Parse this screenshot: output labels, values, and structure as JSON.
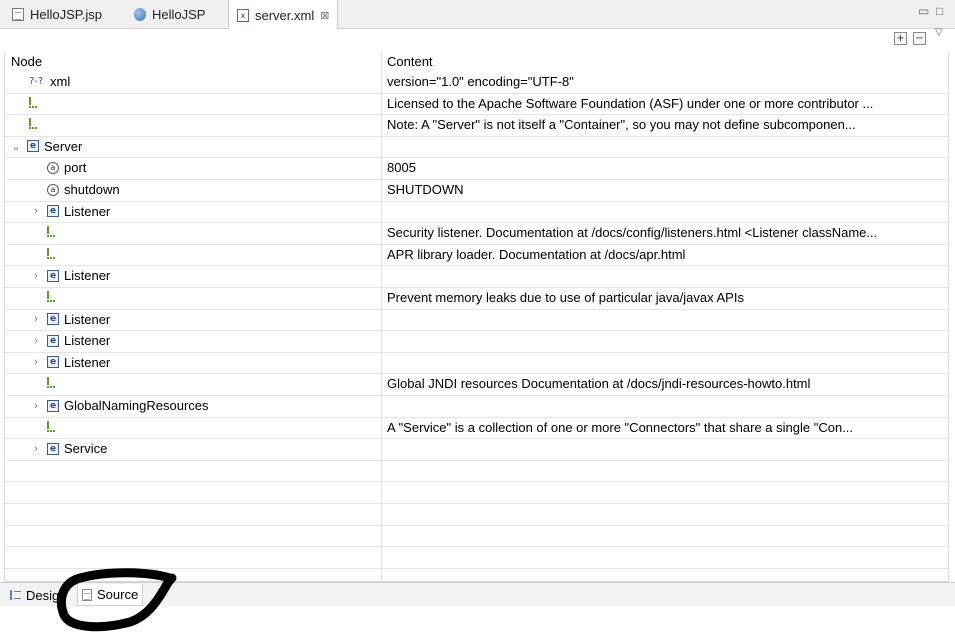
{
  "tabs": [
    {
      "label": "HelloJSP.jsp",
      "icon": "jsp-file-icon",
      "active": false
    },
    {
      "label": "HelloJSP",
      "icon": "globe-icon",
      "active": false
    },
    {
      "label": "server.xml",
      "icon": "xml-file-icon",
      "active": true,
      "close": "⊠"
    }
  ],
  "window_controls": {
    "minimize": "▭",
    "maximize": "□"
  },
  "toolbar": {
    "expand_all": "+",
    "collapse_all": "−",
    "view_menu": "▽"
  },
  "table": {
    "headers": {
      "node": "Node",
      "content": "Content"
    },
    "rows": [
      {
        "type": "xml",
        "label": "xml",
        "content": "version=\"1.0\" encoding=\"UTF-8\""
      },
      {
        "type": "comment",
        "label": "",
        "content": " Licensed to the Apache Software Foundation (ASF) under one or more  contributor ..."
      },
      {
        "type": "comment",
        "label": "",
        "content": "Note:  A \"Server\" is not itself a \"Container\", so you may not     define subcomponen..."
      },
      {
        "type": "element",
        "label": "Server",
        "content": "",
        "twisty": "expanded"
      },
      {
        "type": "attr",
        "label": "port",
        "content": "8005"
      },
      {
        "type": "attr",
        "label": "shutdown",
        "content": "SHUTDOWN"
      },
      {
        "type": "element",
        "label": "Listener",
        "content": "",
        "twisty": "collapsed"
      },
      {
        "type": "comment",
        "label": "",
        "content": "Security listener. Documentation at /docs/config/listeners.html   <Listener className..."
      },
      {
        "type": "comment",
        "label": "",
        "content": "APR library loader. Documentation at /docs/apr.html"
      },
      {
        "type": "element",
        "label": "Listener",
        "content": "",
        "twisty": "collapsed"
      },
      {
        "type": "comment",
        "label": "",
        "content": "Prevent memory leaks due to use of particular java/javax APIs"
      },
      {
        "type": "element",
        "label": "Listener",
        "content": "",
        "twisty": "collapsed"
      },
      {
        "type": "element",
        "label": "Listener",
        "content": "",
        "twisty": "collapsed"
      },
      {
        "type": "element",
        "label": "Listener",
        "content": "",
        "twisty": "collapsed"
      },
      {
        "type": "comment",
        "label": "",
        "content": "Global JNDI resources        Documentation at /docs/jndi-resources-howto.html"
      },
      {
        "type": "element",
        "label": "GlobalNamingResources",
        "content": "",
        "twisty": "collapsed"
      },
      {
        "type": "comment",
        "label": "",
        "content": "A \"Service\" is a collection of one or more \"Connectors\" that share       a single \"Con..."
      },
      {
        "type": "element",
        "label": "Service",
        "content": "",
        "twisty": "collapsed"
      }
    ]
  },
  "bottom_tabs": [
    {
      "label": "Design",
      "icon": "design-icon",
      "selected": false
    },
    {
      "label": "Source",
      "icon": "source-file-icon",
      "selected": true
    }
  ]
}
